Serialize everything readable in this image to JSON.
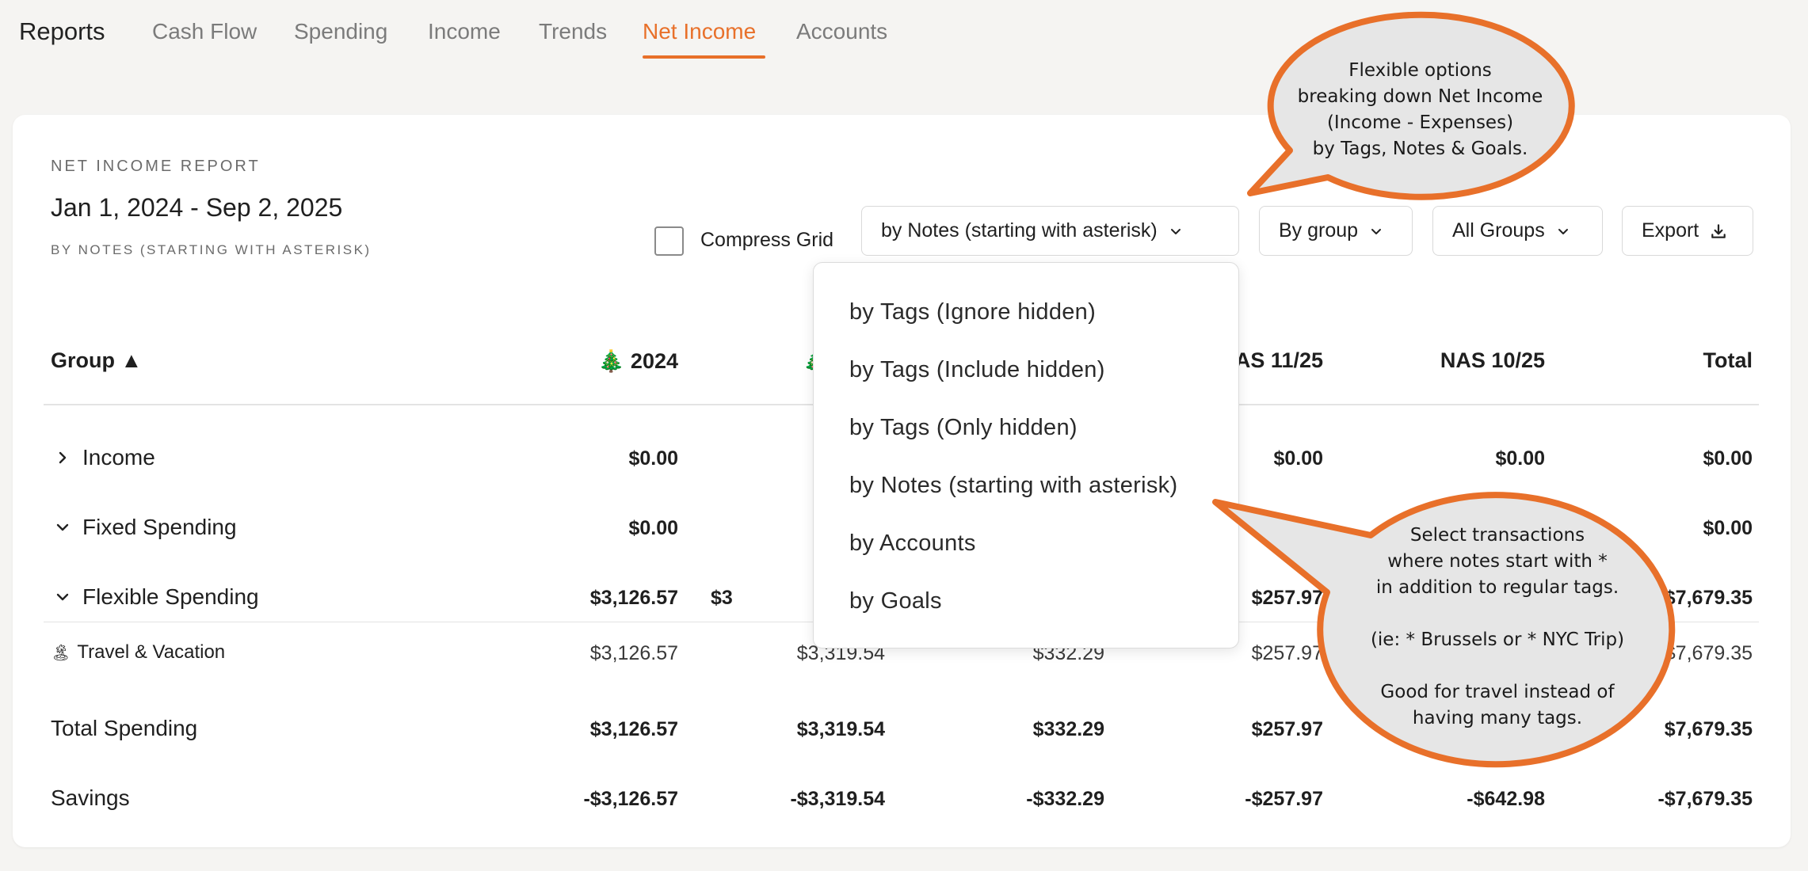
{
  "nav": {
    "title": "Reports",
    "tabs": [
      {
        "label": "Cash Flow"
      },
      {
        "label": "Spending"
      },
      {
        "label": "Income"
      },
      {
        "label": "Trends"
      },
      {
        "label": "Net Income",
        "active": true
      },
      {
        "label": "Accounts"
      }
    ]
  },
  "report": {
    "kicker": "NET INCOME REPORT",
    "date_range": "Jan 1, 2024 - Sep 2, 2025",
    "subtitle": "BY NOTES (STARTING WITH ASTERISK)"
  },
  "controls": {
    "compress_grid_label": "Compress Grid",
    "compress_grid_checked": false,
    "breakdown_select": "by Notes (starting with asterisk)",
    "group_select": "By group",
    "groups_filter": "All Groups",
    "export_label": "Export"
  },
  "dropdown": {
    "items": [
      "by Tags (Ignore hidden)",
      "by Tags (Include hidden)",
      "by Tags (Only hidden)",
      "by Notes (starting with asterisk)",
      "by Accounts",
      "by Goals"
    ]
  },
  "table": {
    "headers": {
      "group": "Group ▲",
      "col1": "🎄 2024",
      "col2": "🎄",
      "col4": "AS 11/25",
      "col5": "NAS 10/25",
      "total": "Total"
    },
    "rows": {
      "income": {
        "label": "Income",
        "c1": "$0.00",
        "c4": "$0.00",
        "c5": "$0.00",
        "total": "$0.00"
      },
      "fixed": {
        "label": "Fixed Spending",
        "c1": "$0.00",
        "total": "$0.00"
      },
      "flexible": {
        "label": "Flexible Spending",
        "c1": "$3,126.57",
        "c2": "$3",
        "c4": "$257.97",
        "total": "$7,679.35"
      },
      "travel": {
        "label": "Travel & Vacation",
        "icon": "🏝",
        "c1": "$3,126.57",
        "c2": "$3,319.54",
        "c3": "$332.29",
        "c4": "$257.97",
        "total": "$7,679.35"
      },
      "total_spending": {
        "label": "Total Spending",
        "c1": "$3,126.57",
        "c2": "$3,319.54",
        "c3": "$332.29",
        "c4": "$257.97",
        "total": "$7,679.35"
      },
      "savings": {
        "label": "Savings",
        "c1": "-$3,126.57",
        "c2": "-$3,319.54",
        "c3": "-$332.29",
        "c4": "-$257.97",
        "c5": "-$642.98",
        "total": "-$7,679.35"
      }
    }
  },
  "callouts": {
    "top": "Flexible options\nbreaking down Net Income\n(Income - Expenses)\nby Tags, Notes & Goals.",
    "bottom": "Select transactions\nwhere notes start with *\nin addition to regular tags.\n\n(ie: * Brussels or * NYC Trip)\n\nGood for travel instead of\nhaving many tags."
  },
  "colors": {
    "accent": "#e8702a",
    "callout_fill": "#e6e6e6",
    "background": "#f5f4f2"
  }
}
